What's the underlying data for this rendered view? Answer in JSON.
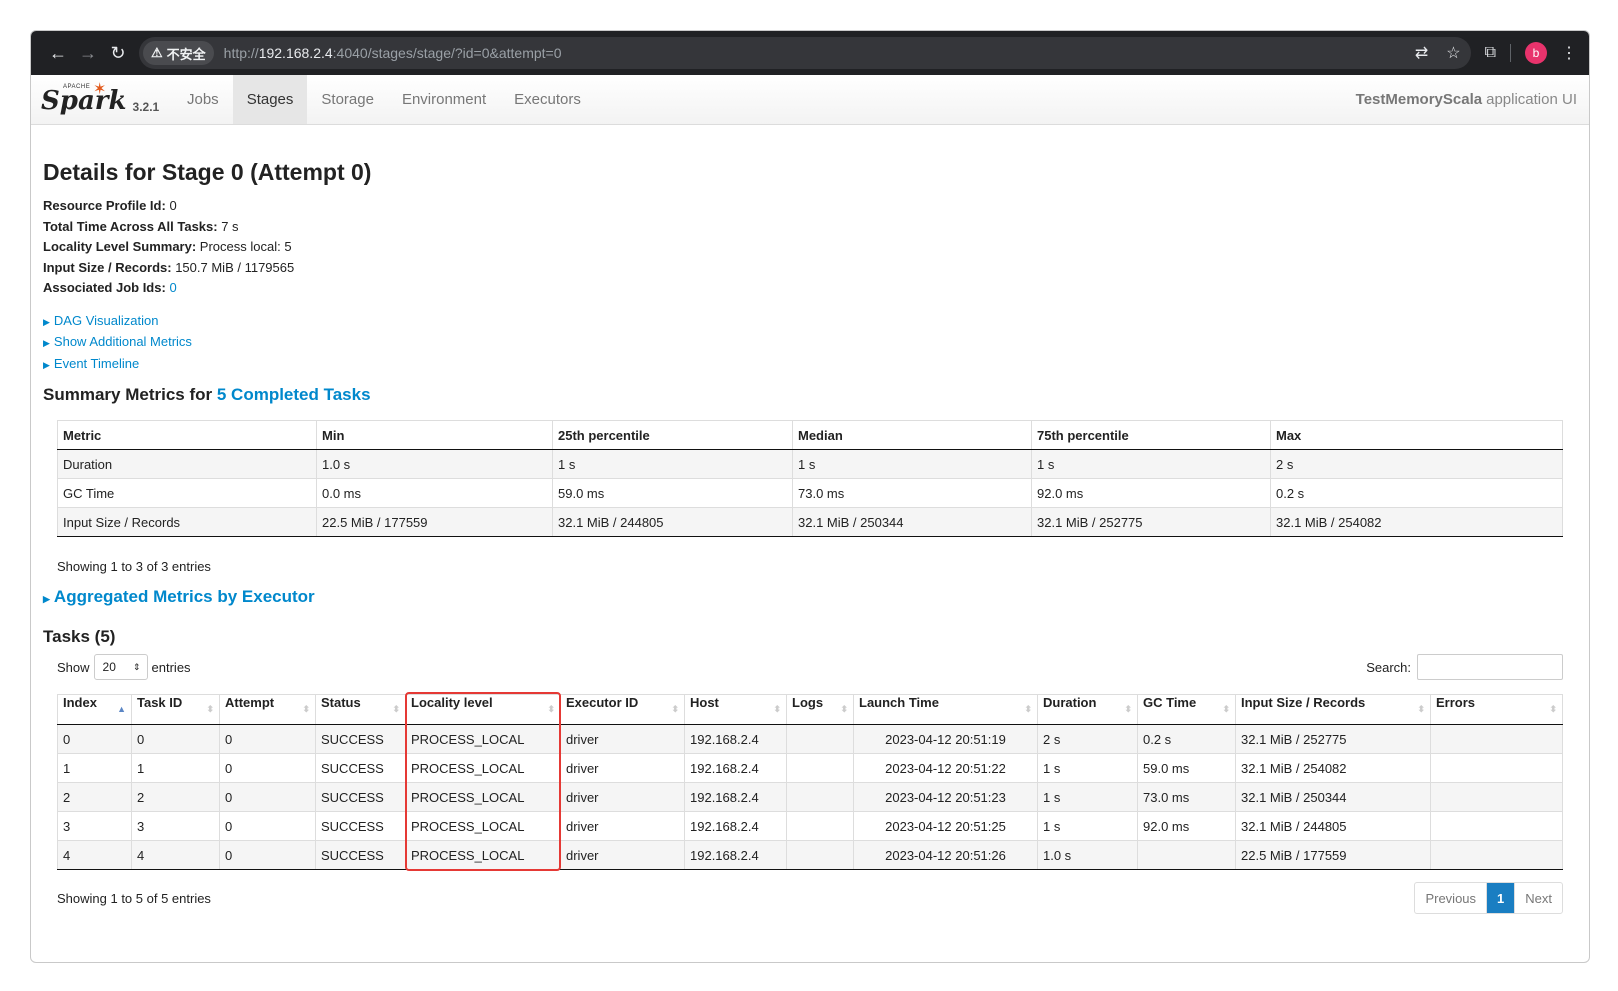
{
  "browser": {
    "security_label": "不安全",
    "url_scheme": "http://",
    "url_host": "192.168.2.4",
    "url_rest": ":4040/stages/stage/?id=0&attempt=0",
    "profile_initial": "b"
  },
  "navbar": {
    "brand_small": "APACHE",
    "brand": "Spark",
    "version": "3.2.1",
    "tabs": [
      "Jobs",
      "Stages",
      "Storage",
      "Environment",
      "Executors"
    ],
    "active_tab": "Stages",
    "app_name": "TestMemoryScala",
    "app_suffix": "application UI"
  },
  "page": {
    "title": "Details for Stage 0 (Attempt 0)",
    "info": [
      {
        "label": "Resource Profile Id:",
        "value": "0"
      },
      {
        "label": "Total Time Across All Tasks:",
        "value": "7 s"
      },
      {
        "label": "Locality Level Summary:",
        "value": "Process local: 5"
      },
      {
        "label": "Input Size / Records:",
        "value": "150.7 MiB / 1179565"
      },
      {
        "label": "Associated Job Ids:",
        "value": "0"
      }
    ],
    "toggles": [
      "DAG Visualization",
      "Show Additional Metrics",
      "Event Timeline"
    ]
  },
  "summary": {
    "heading_prefix": "Summary Metrics for",
    "heading_link": "5 Completed Tasks",
    "columns": [
      "Metric",
      "Min",
      "25th percentile",
      "Median",
      "75th percentile",
      "Max"
    ],
    "rows": [
      [
        "Duration",
        "1.0 s",
        "1 s",
        "1 s",
        "1 s",
        "2 s"
      ],
      [
        "GC Time",
        "0.0 ms",
        "59.0 ms",
        "73.0 ms",
        "92.0 ms",
        "0.2 s"
      ],
      [
        "Input Size / Records",
        "22.5 MiB / 177559",
        "32.1 MiB / 244805",
        "32.1 MiB / 250344",
        "32.1 MiB / 252775",
        "32.1 MiB / 254082"
      ]
    ],
    "entries_info": "Showing 1 to 3 of 3 entries"
  },
  "aggregated": {
    "label": "Aggregated Metrics by Executor"
  },
  "tasks": {
    "heading": "Tasks (5)",
    "show_label": "Show",
    "page_size": "20",
    "entries_label": "entries",
    "search_label": "Search:",
    "columns": [
      "Index",
      "Task ID",
      "Attempt",
      "Status",
      "Locality level",
      "Executor ID",
      "Host",
      "Logs",
      "Launch Time",
      "Duration",
      "GC Time",
      "Input Size / Records",
      "Errors"
    ],
    "rows": [
      [
        "0",
        "0",
        "0",
        "SUCCESS",
        "PROCESS_LOCAL",
        "driver",
        "192.168.2.4",
        "",
        "2023-04-12 20:51:19",
        "2 s",
        "0.2 s",
        "32.1 MiB / 252775",
        ""
      ],
      [
        "1",
        "1",
        "0",
        "SUCCESS",
        "PROCESS_LOCAL",
        "driver",
        "192.168.2.4",
        "",
        "2023-04-12 20:51:22",
        "1 s",
        "59.0 ms",
        "32.1 MiB / 254082",
        ""
      ],
      [
        "2",
        "2",
        "0",
        "SUCCESS",
        "PROCESS_LOCAL",
        "driver",
        "192.168.2.4",
        "",
        "2023-04-12 20:51:23",
        "1 s",
        "73.0 ms",
        "32.1 MiB / 250344",
        ""
      ],
      [
        "3",
        "3",
        "0",
        "SUCCESS",
        "PROCESS_LOCAL",
        "driver",
        "192.168.2.4",
        "",
        "2023-04-12 20:51:25",
        "1 s",
        "92.0 ms",
        "32.1 MiB / 244805",
        ""
      ],
      [
        "4",
        "4",
        "0",
        "SUCCESS",
        "PROCESS_LOCAL",
        "driver",
        "192.168.2.4",
        "",
        "2023-04-12 20:51:26",
        "1.0 s",
        "",
        "22.5 MiB / 177559",
        ""
      ]
    ],
    "entries_info": "Showing 1 to 5 of 5 entries",
    "pager": {
      "previous": "Previous",
      "current": "1",
      "next": "Next"
    }
  },
  "colors": {
    "link": "#0088cc",
    "highlight": "#e53935",
    "pager_active": "#1a7ec2"
  }
}
